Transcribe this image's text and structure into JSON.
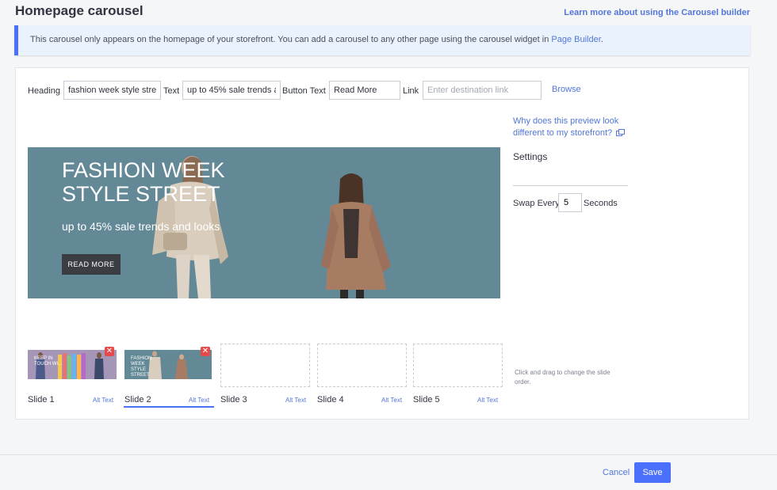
{
  "page": {
    "title": "Homepage carousel",
    "learn_link": "Learn more about using the Carousel builder"
  },
  "notice": {
    "text": "This carousel only appears on the homepage of your storefront. You can add a carousel to any other page using the carousel widget in ",
    "link": "Page Builder",
    "suffix": "."
  },
  "form": {
    "heading_label": "Heading",
    "heading_value": "fashion week style street",
    "text_label": "Text",
    "text_value": "up to 45% sale trends and looks",
    "button_text_label": "Button Text",
    "button_text_value": "Read More",
    "link_label": "Link",
    "link_placeholder": "Enter destination link",
    "browse": "Browse"
  },
  "preview_note": {
    "line1": "Why does this preview look",
    "line2": "different to my storefront?"
  },
  "preview": {
    "heading": "FASHION WEEK STYLE STREET",
    "text": "up to 45% sale trends and looks",
    "button": "READ MORE",
    "background": "#638997"
  },
  "settings": {
    "title": "Settings",
    "swap_label": "Swap Every",
    "swap_value": "5",
    "swap_unit": "Seconds"
  },
  "slides": {
    "items": [
      {
        "label": "Slide 1",
        "alt": "Alt Text",
        "thumb_text": "KEEP IN TOUCH WI..."
      },
      {
        "label": "Slide 2",
        "alt": "Alt Text",
        "thumb_text": "FASHION WEEK STYLE STREET"
      },
      {
        "label": "Slide 3",
        "alt": "Alt Text"
      },
      {
        "label": "Slide 4",
        "alt": "Alt Text"
      },
      {
        "label": "Slide 5",
        "alt": "Alt Text"
      }
    ],
    "active_index": 1,
    "drag_hint": "Click and drag to change the slide order.",
    "delete_icon": "close-icon"
  },
  "footer": {
    "cancel": "Cancel",
    "save": "Save"
  },
  "colors": {
    "accent": "#4b71fc",
    "link": "#5276d8",
    "delete": "#e54a4a"
  }
}
